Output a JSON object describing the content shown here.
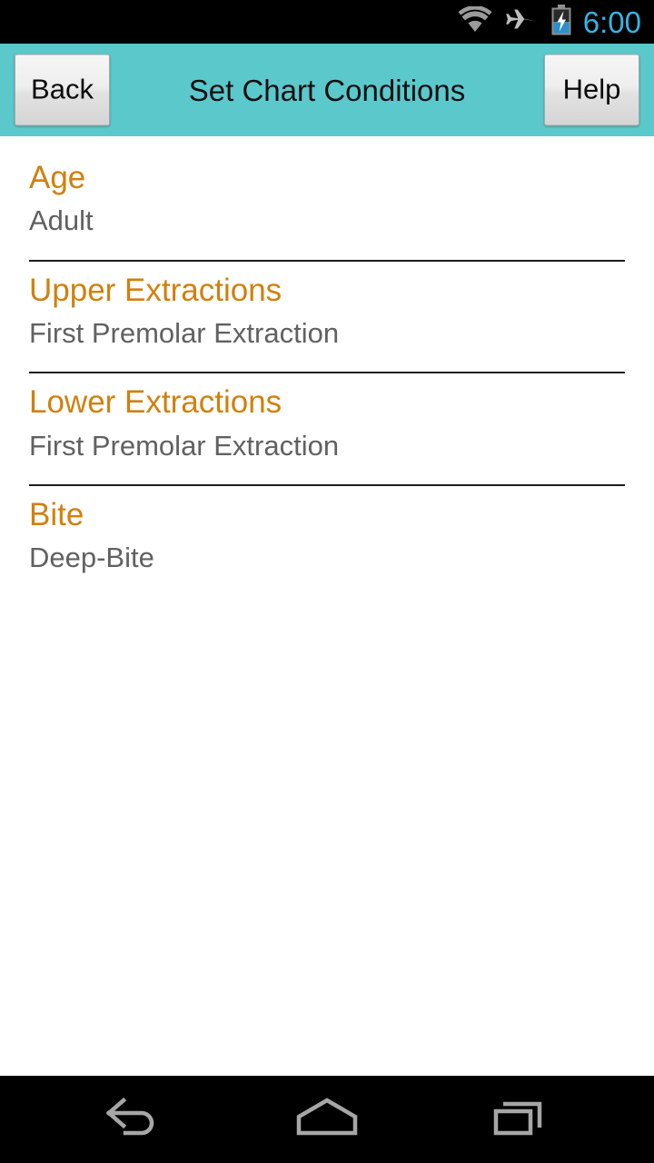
{
  "status_bar": {
    "time": "6:00",
    "time_color": "#33B5E5",
    "icons": [
      {
        "name": "wifi-icon",
        "label": "wifi"
      },
      {
        "name": "airplane-mode-icon",
        "label": "airplane mode"
      },
      {
        "name": "battery-charging-icon",
        "label": "battery charging"
      }
    ]
  },
  "action_bar": {
    "background_color": "#5BC8CC",
    "back_label": "Back",
    "title": "Set Chart Conditions",
    "help_label": "Help"
  },
  "theme": {
    "accent_orange": "#D2800E",
    "subtitle_gray": "#616161",
    "divider_color": "#1d1d1d",
    "page_background": "#ffffff"
  },
  "list": {
    "items": [
      {
        "title": "Age",
        "value": "Adult",
        "divider": true
      },
      {
        "title": "Upper Extractions",
        "value": "First Premolar Extraction",
        "divider": true
      },
      {
        "title": "Lower Extractions",
        "value": "First Premolar Extraction",
        "divider": true
      },
      {
        "title": "Bite",
        "value": "Deep-Bite",
        "divider": false
      }
    ]
  },
  "nav_bar": {
    "buttons": [
      {
        "name": "nav-back-button",
        "label": "Back"
      },
      {
        "name": "nav-home-button",
        "label": "Home"
      },
      {
        "name": "nav-recents-button",
        "label": "Recent apps"
      }
    ]
  }
}
